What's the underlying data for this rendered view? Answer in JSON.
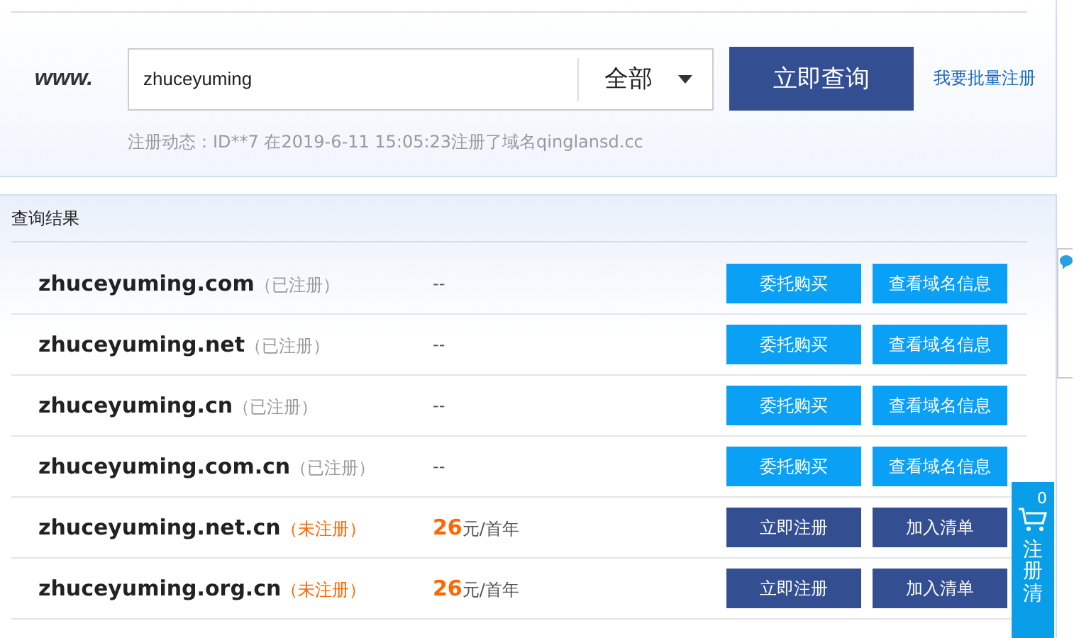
{
  "search": {
    "prefix": "www.",
    "value": "zhuceyuming",
    "dropdown": "全部",
    "button": "立即查询",
    "link": "我要批量注册",
    "activity": "注册动态：ID**7 在2019-6-11 15:05:23注册了域名qinglansd.cc"
  },
  "results": {
    "title": "查询结果",
    "rows": [
      {
        "domain": "zhuceyuming.com",
        "status": "（已注册）",
        "registered": true,
        "price": "--",
        "buttons": [
          "委托购买",
          "查看域名信息"
        ]
      },
      {
        "domain": "zhuceyuming.net",
        "status": "（已注册）",
        "registered": true,
        "price": "--",
        "buttons": [
          "委托购买",
          "查看域名信息"
        ]
      },
      {
        "domain": "zhuceyuming.cn",
        "status": "（已注册）",
        "registered": true,
        "price": "--",
        "buttons": [
          "委托购买",
          "查看域名信息"
        ]
      },
      {
        "domain": "zhuceyuming.com.cn",
        "status": "（已注册）",
        "registered": true,
        "price": "--",
        "buttons": [
          "委托购买",
          "查看域名信息"
        ]
      },
      {
        "domain": "zhuceyuming.net.cn",
        "status": "（未注册）",
        "registered": false,
        "price": "26",
        "price_unit": "元/首年",
        "buttons": [
          "立即注册",
          "加入清单"
        ]
      },
      {
        "domain": "zhuceyuming.org.cn",
        "status": "（未注册）",
        "registered": false,
        "price": "26",
        "price_unit": "元/首年",
        "buttons": [
          "立即注册",
          "加入清单"
        ]
      }
    ]
  },
  "cart": {
    "count": "0",
    "label": "注册清"
  }
}
